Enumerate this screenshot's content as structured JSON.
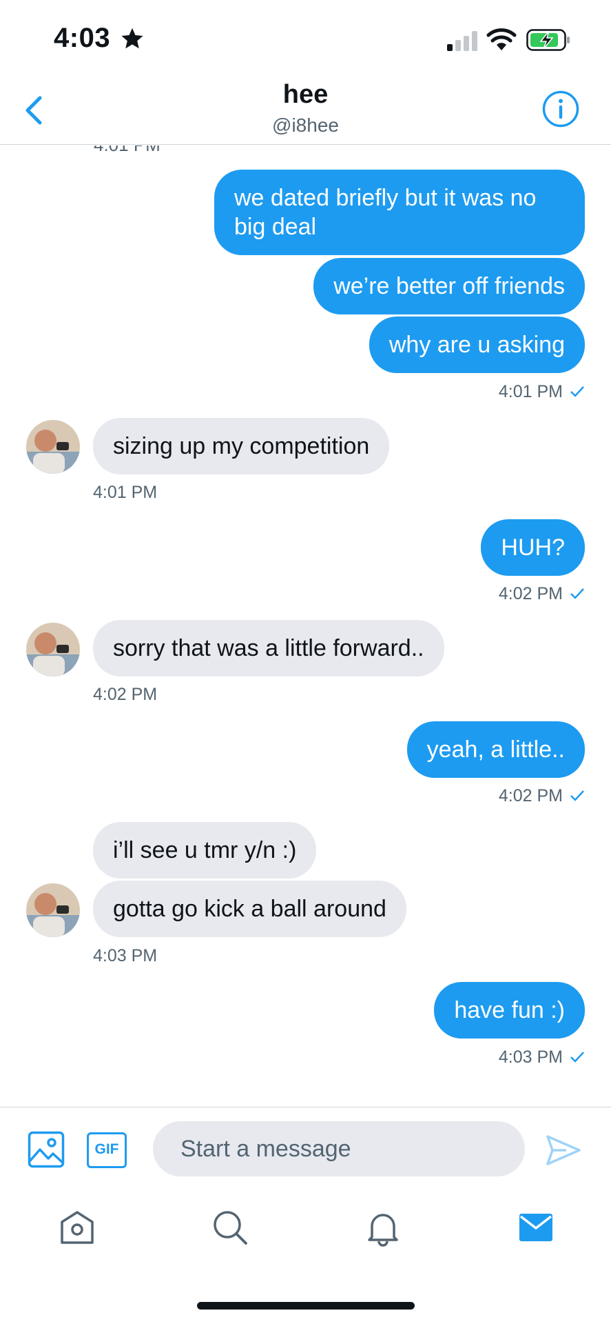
{
  "status_bar": {
    "time": "4:03",
    "icons": [
      "star-icon",
      "signal-icon",
      "wifi-icon",
      "battery-charging-icon"
    ]
  },
  "header": {
    "name": "hee",
    "handle": "@i8hee",
    "icons": [
      "back-chevron-icon",
      "info-icon"
    ]
  },
  "conversation": {
    "cut_timestamp": "4:01 PM",
    "messages": [
      {
        "direction": "out",
        "text": "we dated briefly but it was no big deal"
      },
      {
        "direction": "out",
        "text": "we’re better off friends"
      },
      {
        "direction": "out",
        "text": "why are u asking",
        "time": "4:01 PM",
        "read": true
      },
      {
        "direction": "in",
        "text": "sizing up my competition",
        "time": "4:01 PM"
      },
      {
        "direction": "out",
        "text": "HUH?",
        "time": "4:02 PM",
        "read": true
      },
      {
        "direction": "in",
        "text": "sorry that was a little forward..",
        "time": "4:02 PM"
      },
      {
        "direction": "out",
        "text": "yeah, a little..",
        "time": "4:02 PM",
        "read": true
      },
      {
        "direction": "in",
        "text": "i’ll see u tmr y/n :)"
      },
      {
        "direction": "in",
        "text": "gotta go kick a ball around",
        "time": "4:03 PM"
      },
      {
        "direction": "out",
        "text": "have fun :)",
        "time": "4:03 PM",
        "read": true
      }
    ]
  },
  "composer": {
    "gif_label": "GIF",
    "placeholder": "Start a message",
    "icons": [
      "image-icon",
      "gif-icon",
      "send-icon"
    ]
  },
  "tab_bar": {
    "tabs": [
      "home-icon",
      "search-icon",
      "notifications-bell-icon",
      "messages-envelope-icon"
    ],
    "active": "messages"
  },
  "colors": {
    "accent": "#1d9bf0",
    "incoming_bubble": "#e7e9ee",
    "secondary_text": "#536471",
    "primary_text": "#0f1419"
  }
}
